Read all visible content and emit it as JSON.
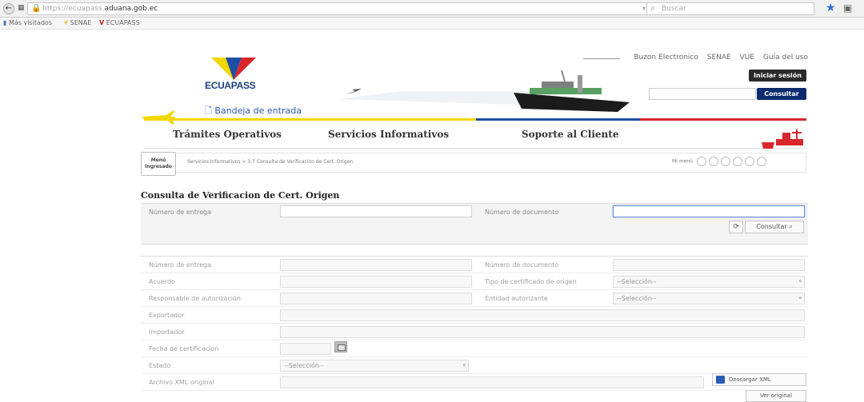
{
  "browser": {
    "url_prefix": "https://ecuapass.",
    "url_domain": "aduana.gob.ec",
    "search_placeholder": "Buscar",
    "bookmarks": [
      "Más visitados",
      "SENAE",
      "ECUAPASS"
    ]
  },
  "header": {
    "logo": "ECUAPASS",
    "inbox_link": "Bandeja de entrada",
    "top_links": [
      "Buzon Electronico",
      "SENAE",
      "VUE",
      "Guía del uso"
    ],
    "session_button": "Iniciar sesión",
    "consult_button": "Consultar"
  },
  "menu": {
    "items": [
      "Trámites Operativos",
      "Servicios Informativos",
      "Soporte al Cliente"
    ],
    "colors": {
      "yellow": "#f1d600",
      "blue": "#1f4fa5",
      "red": "#d8262b"
    }
  },
  "breadcrumb": {
    "home_tab": "Menú Ingresado",
    "path": "Servicios Informativos  >  3.7 Consulta de Verificacion de Cert. Origen",
    "my_menu": "Mi menú"
  },
  "page": {
    "title": "Consulta de Verificacion de Cert. Origen"
  },
  "search_form": {
    "delivery_label": "Número de entrega",
    "delivery_value": "",
    "document_label": "Número de documento",
    "document_value": "",
    "search_button": "Consultar"
  },
  "result": {
    "delivery_number": "Número de entrega",
    "document_number": "Número de documento",
    "agreement": "Acuerdo",
    "certificate_type": "Tipo de certificado de origen",
    "authorization_responsible": "Responsable de autorización",
    "authorizing_entity": "Entidad autorizante",
    "exporter": "Exportador",
    "importer": "Importador",
    "certification_date": "Fecha de certificacion",
    "status": "Estado",
    "original_xml": "Archivo XML original",
    "select_placeholder": "--Selección--",
    "download_xml": "Descargar XML",
    "view_original": "Ver original"
  }
}
